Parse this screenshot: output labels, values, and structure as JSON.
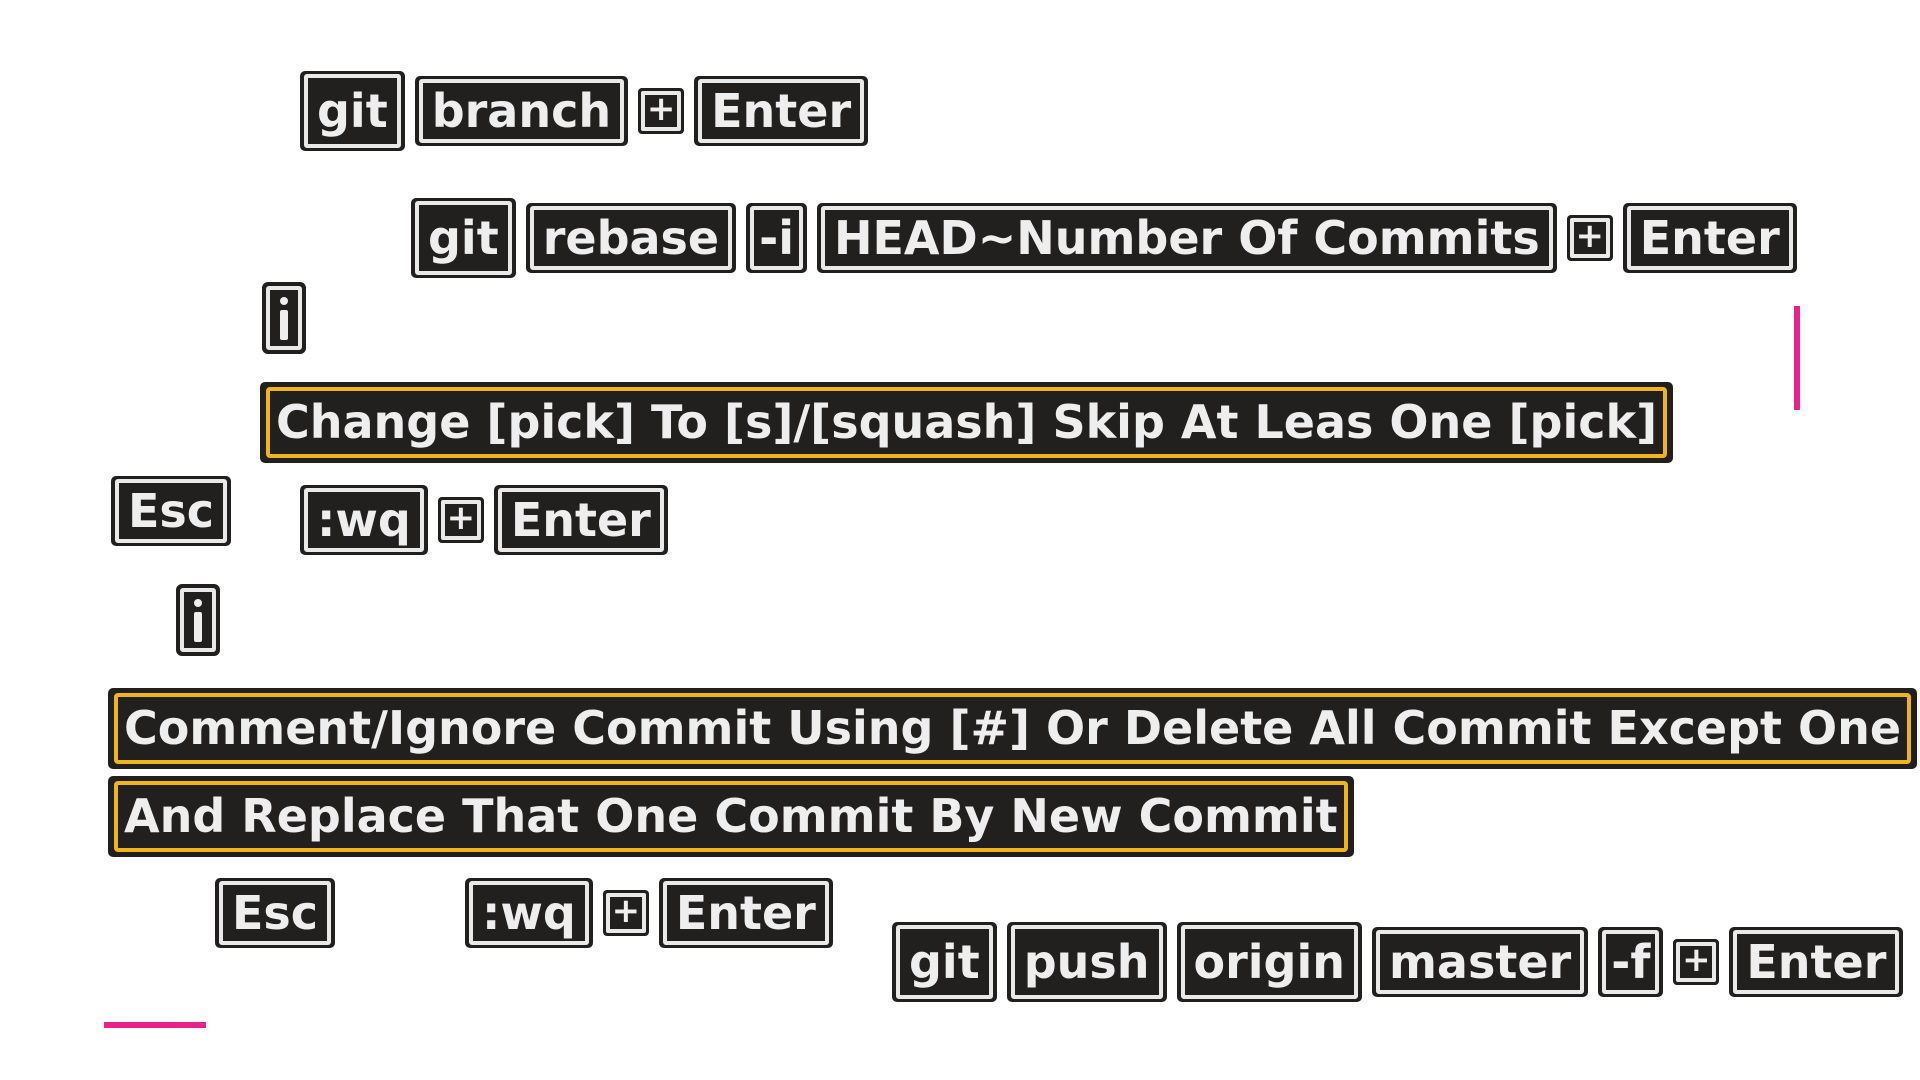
{
  "steps": {
    "branch": {
      "keys": [
        "git",
        "branch"
      ],
      "enter": "Enter"
    },
    "rebase": {
      "keys": [
        "git",
        "rebase",
        "-i",
        "HEAD~Number Of Commits"
      ],
      "enter": "Enter"
    },
    "pick_note": "Change [pick] To [s]/[squash] Skip At Leas One [pick]",
    "save1": {
      "esc": "Esc",
      "wq": ":wq",
      "enter": "Enter"
    },
    "comment_note_line1": "Comment/Ignore Commit Using [#] Or Delete All Commit Except One",
    "comment_note_line2": "And Replace That One Commit By New Commit",
    "save2": {
      "esc": "Esc",
      "wq": ":wq",
      "enter": "Enter"
    },
    "push": {
      "keys": [
        "git",
        "push",
        "origin",
        "master",
        "-f"
      ],
      "enter": "Enter"
    }
  },
  "icons": {
    "plus": "plus-key-icon",
    "insert": "insert-mode-i-icon"
  },
  "colors": {
    "key_background": "#221f1f",
    "key_text": "#eeeeee",
    "note_border": "#f0b41c",
    "accent": "#e6238d"
  }
}
